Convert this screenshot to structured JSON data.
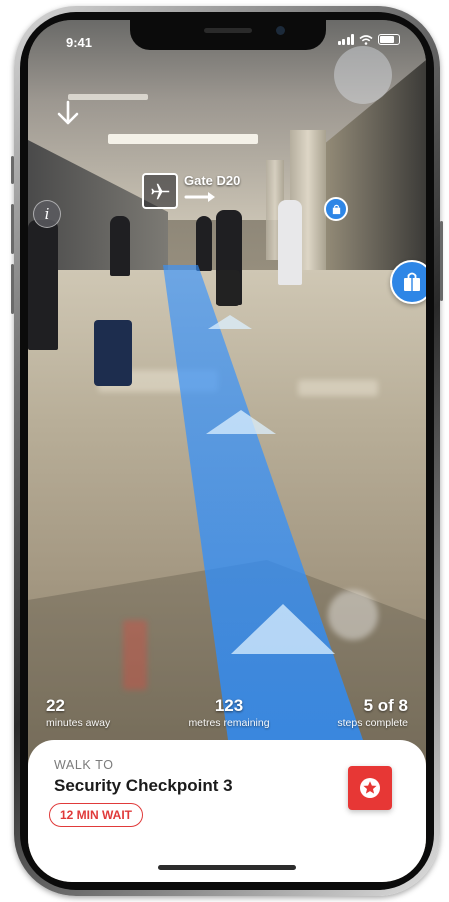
{
  "status_bar": {
    "time": "9:41"
  },
  "ar_view": {
    "gate_label": "Gate D20",
    "icons": [
      "back-arrow-icon",
      "info-icon",
      "plane-icon",
      "arrow-right-icon",
      "shopping-bag-icon"
    ]
  },
  "stats": [
    {
      "value": "22",
      "label": "minutes away"
    },
    {
      "value": "123",
      "label": "metres remaining"
    },
    {
      "value": "5 of 8",
      "label": "steps complete"
    }
  ],
  "card": {
    "eyebrow": "WALK TO",
    "title": "Security Checkpoint 3",
    "wait": "12 MIN WAIT"
  },
  "colors": {
    "accent_red": "#e73735",
    "path_blue": "#3c96ff",
    "poi_blue": "#2e86e6"
  }
}
